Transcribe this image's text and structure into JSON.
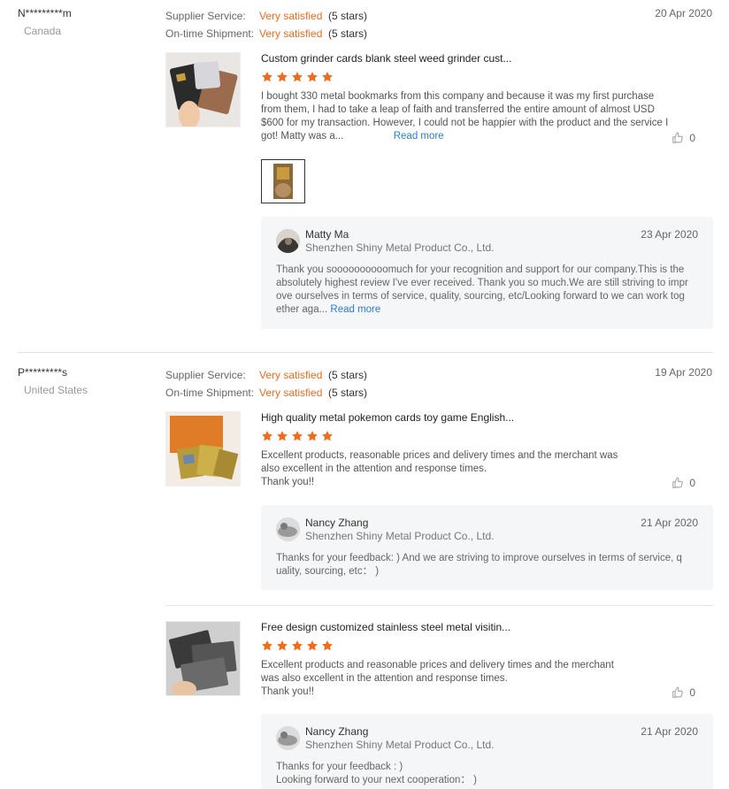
{
  "reviews": [
    {
      "buyer": "N*********m",
      "country": "Canada",
      "date": "20 Apr 2020",
      "supplier_label": "Supplier Service:",
      "supplier_value": "Very satisfied",
      "supplier_stars": "(5 stars)",
      "shipment_label": "On-time Shipment:",
      "shipment_value": "Very satisfied",
      "shipment_stars": "(5 stars)",
      "product_title": "Custom grinder cards blank steel weed grinder cust...",
      "rating": 5,
      "text": "I bought 330 metal bookmarks from this company and because it was my first purchase from them, I had to take a leap of faith and transferred the entire amount of almost USD $600 for my transaction. However, I could not be happier with the product and the service I got! Matty was a...",
      "read_more": "Read more",
      "likes": "0",
      "reply": {
        "name": "Matty Ma",
        "company": "Shenzhen Shiny Metal Product Co., Ltd.",
        "date": "23 Apr 2020",
        "text": "Thank you soooooooooomuch for your recognition and support for our company.This is the absolutely highest review I've ever received. Thank you so much.We are still striving to impr ove ourselves in terms of service, quality, sourcing, etc/Looking forward to we can work tog ether aga...",
        "read_more": "Read more"
      }
    },
    {
      "buyer": "P*********s",
      "country": "United States",
      "date": "19 Apr 2020",
      "supplier_label": "Supplier Service:",
      "supplier_value": "Very satisfied",
      "supplier_stars": "(5 stars)",
      "shipment_label": "On-time Shipment:",
      "shipment_value": "Very satisfied",
      "shipment_stars": "(5 stars)",
      "items": [
        {
          "product_title": "High quality metal pokemon cards toy game English...",
          "rating": 5,
          "text_line1": "Excellent products, reasonable prices and delivery times and the merchant was",
          "text_line2": "also excellent in the attention and response times.",
          "text_line3": "Thank you!!",
          "likes": "0",
          "reply": {
            "name": "Nancy Zhang",
            "company": "Shenzhen Shiny Metal Product Co., Ltd.",
            "date": "21 Apr 2020",
            "text": "Thanks for your feedback: )  And we are striving to improve ourselves in terms of service, q uality, sourcing, etc： )"
          }
        },
        {
          "product_title": "Free design customized stainless steel metal visitin...",
          "rating": 5,
          "text_line1": "Excellent products and reasonable prices and delivery times and the merchant",
          "text_line2": "was also excellent in the attention and response times.",
          "text_line3": "Thank you!!",
          "likes": "0",
          "reply": {
            "name": "Nancy Zhang",
            "company": "Shenzhen Shiny Metal Product Co., Ltd.",
            "date": "21 Apr 2020",
            "text_line1": "Thanks for your feedback : )",
            "text_line2": "Looking forward to your next cooperation： )"
          }
        }
      ]
    }
  ],
  "colors": {
    "accent": "#f26a1b",
    "link": "#2a7bd5",
    "reply_bg": "#f5f6f7"
  },
  "icons": {
    "star": "star-icon",
    "like": "thumbs-up-icon"
  }
}
